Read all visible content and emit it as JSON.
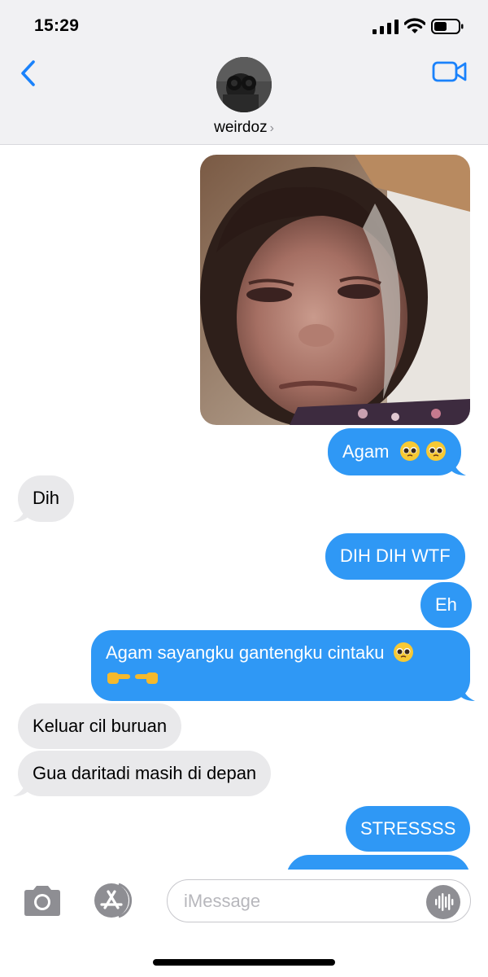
{
  "status_bar": {
    "time": "15:29"
  },
  "header": {
    "contact_name": "weirdoz",
    "chevron": "›"
  },
  "messages": [
    {
      "from": "me",
      "type": "image",
      "description": ""
    },
    {
      "from": "me",
      "text": "Agam",
      "emoji": [
        "pleading-face",
        "pleading-face"
      ]
    },
    {
      "from": "them",
      "text": "Dih"
    },
    {
      "from": "me",
      "text": "DIH DIH WTF"
    },
    {
      "from": "me",
      "text": "Eh"
    },
    {
      "from": "me",
      "text": "Agam sayangku gantengku cintaku",
      "emoji": [
        "pleading-face",
        "pointing-fingers"
      ]
    },
    {
      "from": "them",
      "text": "Keluar cil buruan"
    },
    {
      "from": "them",
      "text": "Gua daritadi masih di depan"
    },
    {
      "from": "me",
      "text": "STRESSSS"
    }
  ],
  "input_bar": {
    "placeholder": "iMessage"
  },
  "icons": [
    "back-chevron-icon",
    "video-camera-icon",
    "camera-icon",
    "app-store-icon",
    "audio-waveform-icon",
    "signal-icon",
    "wifi-icon",
    "battery-icon"
  ],
  "colors": {
    "outgoing_bubble": "#2f98f5",
    "incoming_bubble": "#e9e9eb",
    "accent": "#1a82fb",
    "header_bg": "#f1f1f3"
  }
}
